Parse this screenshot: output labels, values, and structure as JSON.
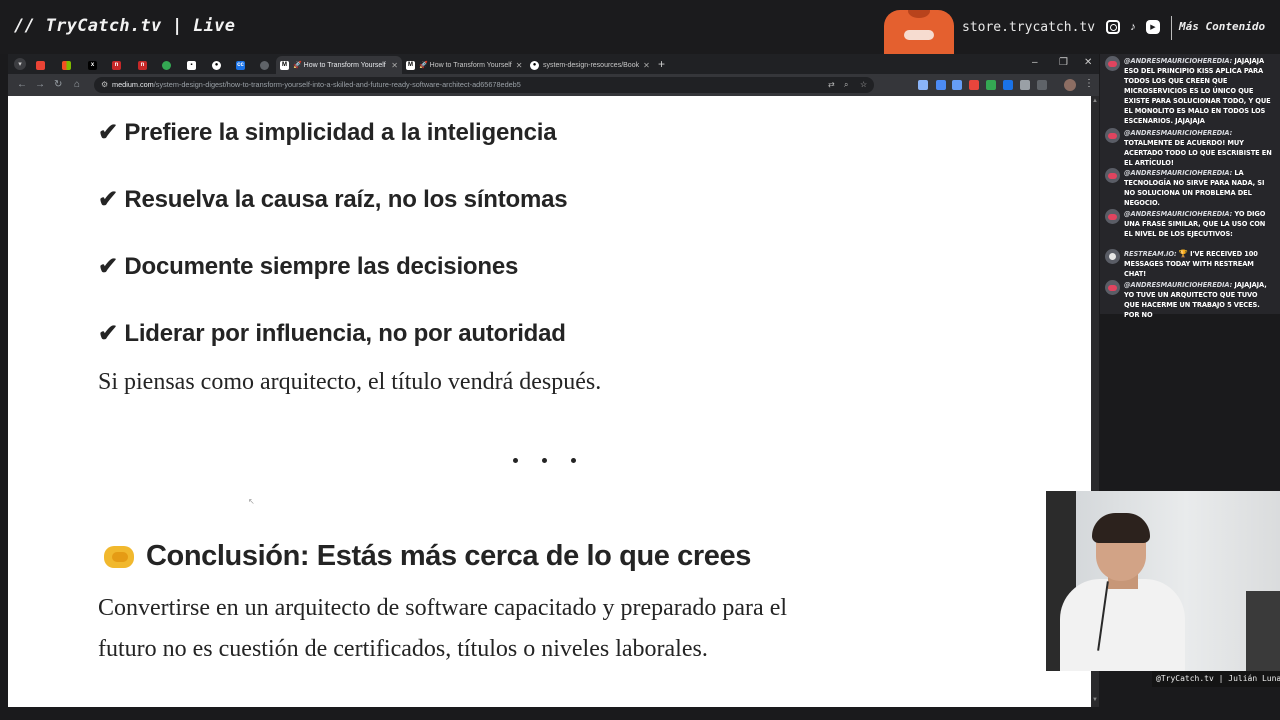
{
  "stream": {
    "brand": "// TryCatch.tv | Live",
    "store": "store.trycatch.tv",
    "more": "Más Contenido",
    "social_icons": [
      "instagram-icon",
      "tiktok-icon",
      "youtube-icon"
    ]
  },
  "browser": {
    "tabs": [
      {
        "icon": "gmail-icon",
        "label": ""
      },
      {
        "icon": "microsoft-icon",
        "label": ""
      },
      {
        "icon": "x-icon",
        "label": ""
      },
      {
        "icon": "n-icon",
        "label": ""
      },
      {
        "icon": "n-icon",
        "label": ""
      },
      {
        "icon": "chrome-icon",
        "label": ""
      },
      {
        "icon": "square-icon",
        "label": ""
      },
      {
        "icon": "github-icon",
        "label": ""
      },
      {
        "icon": "cc-icon",
        "label": ""
      },
      {
        "icon": "globe-icon",
        "label": ""
      },
      {
        "icon": "medium-icon",
        "label": "🚀 How to Transform Yourself",
        "active": true
      },
      {
        "icon": "medium-icon",
        "label": "🚀 How to Transform Yourself"
      },
      {
        "icon": "github-icon",
        "label": "system-design-resources/Book"
      }
    ],
    "url_host": "medium.com",
    "url_path": "/system-design-digest/how-to-transform-yourself-into-a-skilled-and-future-ready-software-architect-ad65678edeb5"
  },
  "article": {
    "principles": [
      "✔ Prefiere la simplicidad a la inteligencia",
      "✔ Resuelva la causa raíz, no los síntomas",
      "✔ Documente siempre las decisiones",
      "✔ Liderar por influencia, no por autoridad"
    ],
    "closing": "Si piensas como arquitecto, el título vendrá después.",
    "conclusion_heading": "Conclusión: Estás más cerca de lo que crees",
    "conclusion_lines": [
      "Convertirse en un arquitecto de software capacitado y preparado para el",
      "futuro no es cuestión de certificados, títulos o niveles laborales."
    ]
  },
  "chat": [
    {
      "user": "@andresmauricioheredia:",
      "text": "jajajaja eso del principio KISS aplica para todos los que creen que microservicios es lo único que existe para solucionar todo, y que el monolito es malo en todos los escenarios. jajajaja"
    },
    {
      "user": "@andresmauricioheredia:",
      "text": "totalmente de acuerdo! muy acertado todo lo que escribiste en el artículo!"
    },
    {
      "user": "@andresmauricioheredia:",
      "text": "la tecnología no sirve para nada, si no soluciona un problema del negocio."
    },
    {
      "user": "@andresmauricioheredia:",
      "text": "yo digo una frase similar, que la uso con el nivel de los ejecutivos:"
    },
    {
      "user": "restream.io:",
      "text": "🏆 I've received 100 messages today with Restream Chat!"
    },
    {
      "user": "@andresmauricioheredia:",
      "text": "jajajaja, yo tuve un arquitecto que tuvo que hacerme un trabajo 5 veces. por no"
    }
  ],
  "webcam": {
    "label": "@TryCatch.tv | Julián Luna"
  }
}
